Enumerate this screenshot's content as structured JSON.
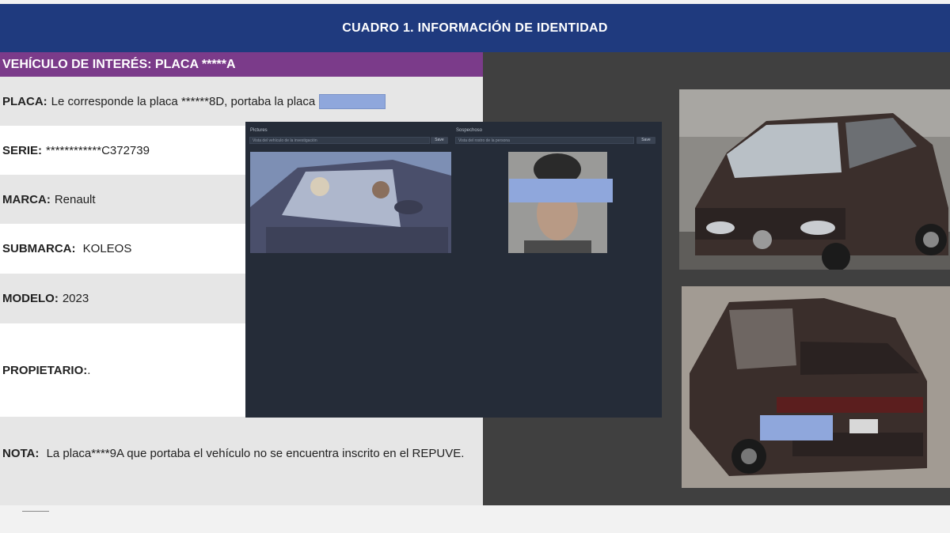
{
  "header": {
    "title": "CUADRO 1. INFORMACIÓN DE IDENTIDAD"
  },
  "vehicle": {
    "title": "VEHÍCULO DE INTERÉS: PLACA *****A",
    "rows": [
      {
        "label": "PLACA:",
        "value": "Le corresponde la placa ******8D, portaba la placa"
      },
      {
        "label": "SERIE:",
        "value": "************C372739"
      },
      {
        "label": "MARCA:",
        "value": "Renault"
      },
      {
        "label": "SUBMARCA:",
        "value": " KOLEOS"
      },
      {
        "label": "MODELO:",
        "value": "2023"
      },
      {
        "label": "PROPIETARIO:",
        "value": "."
      }
    ],
    "note": {
      "label": "NOTA:",
      "value": "La placa****9A que portaba el vehículo no se encuentra inscrito en el REPUVE."
    }
  },
  "overlay": {
    "left_label": "Pictures",
    "right_label": "Sospechoso",
    "left_input": "Vista del vehículo de la investigación",
    "right_input": "Vista del rostro de la persona",
    "button": "Save"
  },
  "images": {
    "car_front": "photo-car-front",
    "car_rear": "photo-car-rear",
    "driver": "photo-driver",
    "suspect": "photo-suspect"
  },
  "colors": {
    "header": "#1f3a7e",
    "vehicle_title": "#7b3b8a",
    "redaction": "#8fa7dc",
    "panel": "#404040",
    "overlay": "#252c38"
  }
}
